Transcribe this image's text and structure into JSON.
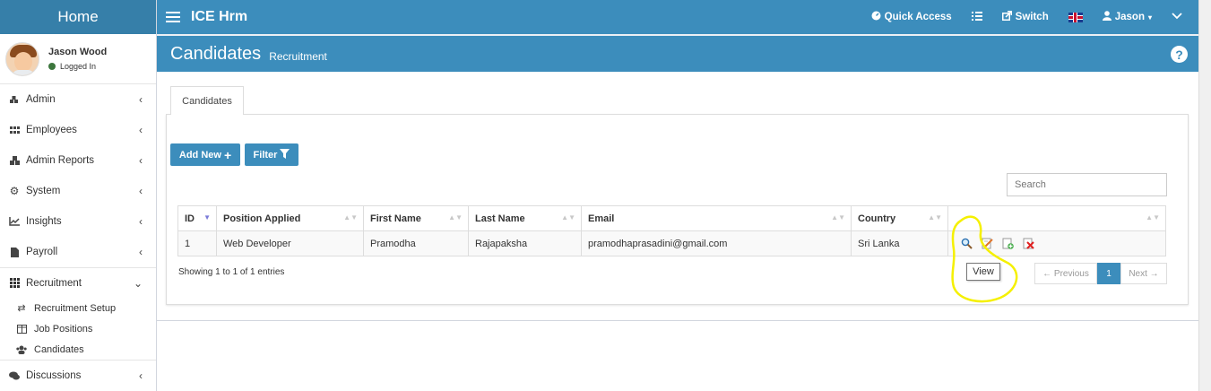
{
  "sidebar": {
    "logo": "Home",
    "user": {
      "name": "Jason Wood",
      "status": "Logged In"
    },
    "items": [
      {
        "label": "Admin",
        "icon": "cubes-icon"
      },
      {
        "label": "Employees",
        "icon": "grid-icon"
      },
      {
        "label": "Admin Reports",
        "icon": "cube-icon"
      },
      {
        "label": "System",
        "icon": "cogs-icon"
      },
      {
        "label": "Insights",
        "icon": "line-chart-icon"
      },
      {
        "label": "Payroll",
        "icon": "document-icon"
      },
      {
        "label": "Recruitment",
        "icon": "th-icon"
      }
    ],
    "submenu": [
      {
        "label": "Recruitment Setup",
        "icon": "random-icon"
      },
      {
        "label": "Job Positions",
        "icon": "columns-icon"
      },
      {
        "label": "Candidates",
        "icon": "users-icon"
      }
    ],
    "discussions": "Discussions"
  },
  "topbar": {
    "app_title": "ICE Hrm",
    "quick_access": "Quick Access",
    "switch": "Switch",
    "user": "Jason"
  },
  "header": {
    "title": "Candidates",
    "subtitle": "Recruitment",
    "help": "?"
  },
  "tabs": [
    "Candidates"
  ],
  "toolbar": {
    "add_new": "Add New",
    "filter": "Filter",
    "search_placeholder": "Search"
  },
  "table": {
    "columns": [
      "ID",
      "Position Applied",
      "First Name",
      "Last Name",
      "Email",
      "Country",
      ""
    ],
    "rows": [
      [
        "1",
        "Web Developer",
        "Pramodha",
        "Rajapaksha",
        "pramodhaprasadini@gmail.com",
        "Sri Lanka"
      ]
    ]
  },
  "footer": {
    "showing": "Showing 1 to 1 of 1 entries",
    "previous": "← Previous",
    "page": "1",
    "next": "Next →"
  },
  "tooltip": "View",
  "colors": {
    "primary": "#3c8dbc",
    "logo_bg": "#367fa9",
    "annotation": "#f5f000"
  }
}
